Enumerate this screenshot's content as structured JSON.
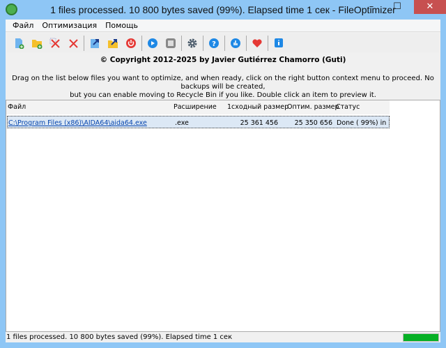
{
  "window": {
    "title": "1 files processed. 10 800 bytes saved (99%). Elapsed time  1 сек - FileOptimizer",
    "minimize": "–",
    "maximize": "☐",
    "close": "✕"
  },
  "menu": [
    "Файл",
    "Оптимизация",
    "Помощь"
  ],
  "toolbar": [
    "add-files",
    "add-folder",
    "clear-selected",
    "clear-all",
    "open-file",
    "open-folder",
    "exit",
    "optimize",
    "stop",
    "options",
    "help",
    "stats",
    "donate",
    "about"
  ],
  "copyright": "© Copyright 2012-2025 by Javier Gutiérrez Chamorro (Guti)",
  "instructions": [
    "Drag on the list below files you want to optimize, and when ready, click on the right button context menu to proceed. No backups will be created,",
    "but you can enable moving to Recycle Bin if you like. Double click an item to preview it."
  ],
  "list": {
    "columns": [
      "Файл",
      "Расширение",
      "1сходный размер",
      "Оптим. размер",
      "Статус"
    ],
    "rows": [
      {
        "file": "C:\\Program Files (x86)\\AIDA64\\aida64.exe",
        "ext": ".exe",
        "orig": "25 361 456",
        "opt": "25 350 656",
        "status": "Done ( 99%) in  1"
      }
    ]
  },
  "status": {
    "text": "1 files processed. 10 800 bytes saved (99%). Elapsed time  1 сек",
    "progress_percent": 100,
    "progress_color": "#06b025"
  }
}
